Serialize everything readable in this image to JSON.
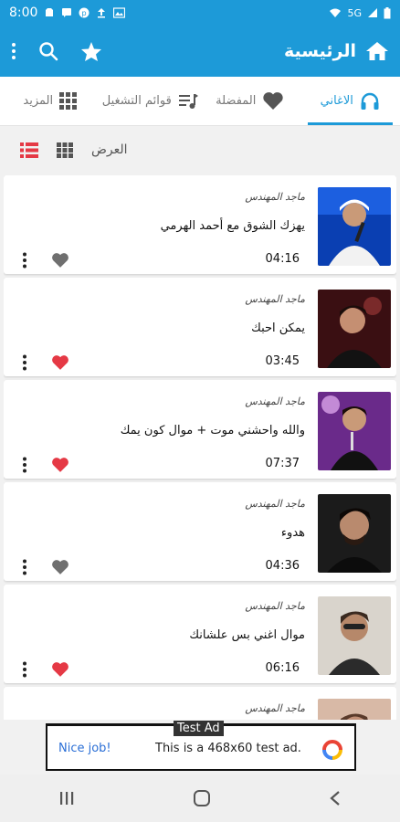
{
  "status_bar": {
    "time": "8:00",
    "signal_text": "5G",
    "left_icons": [
      "clock-icon",
      "chat-icon",
      "pinterest-icon",
      "upload-icon",
      "image-icon"
    ],
    "right_icons": [
      "wifi-icon",
      "signal-icon",
      "battery-icon"
    ]
  },
  "app_bar": {
    "title": "الرئيسية",
    "icons": [
      "home-icon",
      "star-icon",
      "search-icon",
      "overflow-menu-icon"
    ],
    "color": "#1d9ad8"
  },
  "tabs": [
    {
      "label": "الاغاني",
      "icon": "headphones-icon",
      "active": true
    },
    {
      "label": "المفضلة",
      "icon": "heart-icon",
      "active": false
    },
    {
      "label": "قوائم التشغيل",
      "icon": "playlist-icon",
      "active": false
    },
    {
      "label": "المزيد",
      "icon": "grid-icon",
      "active": false
    }
  ],
  "view": {
    "label": "العرض",
    "options": [
      "grid-view-icon",
      "list-view-icon"
    ]
  },
  "songs": [
    {
      "artist": "ماجد المهندس",
      "title": "يهزك الشوق مع أحمد الهرمي",
      "duration": "04:16",
      "favorite": false
    },
    {
      "artist": "ماجد المهندس",
      "title": "يمكن احبك",
      "duration": "03:45",
      "favorite": true
    },
    {
      "artist": "ماجد المهندس",
      "title": "والله واحشني موت + موال كون يمك",
      "duration": "07:37",
      "favorite": true
    },
    {
      "artist": "ماجد المهندس",
      "title": "هدوء",
      "duration": "04:36",
      "favorite": false
    },
    {
      "artist": "ماجد المهندس",
      "title": "موال اغني بس علشانك",
      "duration": "06:16",
      "favorite": true
    },
    {
      "artist": "ماجد المهندس",
      "title": "",
      "duration": "",
      "favorite": false
    }
  ],
  "ad": {
    "label": "Test Ad",
    "nice": "Nice job!",
    "text": "This is a 468x60 test ad."
  },
  "colors": {
    "accent": "#1d9ad8",
    "favorite": "#e53945",
    "not_favorite": "#6f6f6f",
    "list_view_active": "#e53945"
  }
}
